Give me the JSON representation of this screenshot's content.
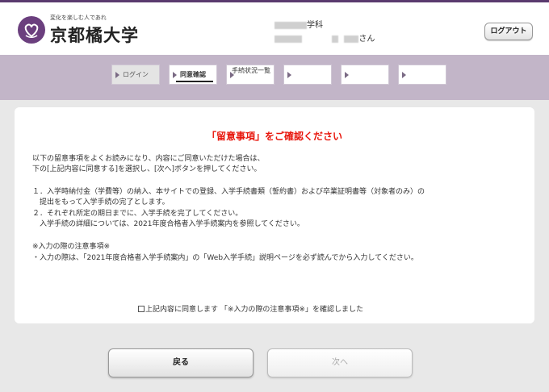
{
  "header": {
    "tagline": "変化を楽しむ人であれ",
    "university_name": "京都橘大学",
    "department_suffix": "学科",
    "user_suffix": "さん",
    "logout_label": "ログアウト"
  },
  "steps": [
    {
      "label": "ログイン",
      "state": "done"
    },
    {
      "label": "同意確認",
      "state": "current"
    },
    {
      "label": "手続状況一覧",
      "state": "todo"
    },
    {
      "label": "",
      "state": "todo"
    },
    {
      "label": "",
      "state": "todo"
    },
    {
      "label": "",
      "state": "todo"
    }
  ],
  "notice": {
    "title": "「留意事項」をご確認ください",
    "intro_1": "以下の留意事項をよくお読みになり、内容にご同意いただけた場合は、",
    "intro_2": "下の[上記内容に同意する]を選択し、[次へ]ボタンを押してください。",
    "item1_line1": "１．入学時納付金（学費等）の納入、本サイトでの登録、入学手続書類（誓約書）および卒業証明書等（対象者のみ）の",
    "item1_line2": "　提出をもって入学手続の完了とします。",
    "item2_line1": "２．それぞれ所定の期日までに、入学手続を完了してください。",
    "item2_line2": "　入学手続の詳細については、2021年度合格者入学手続案内を参照してください。",
    "caution_heading": "※入力の際の注意事項※",
    "caution_text": "・入力の際は、「2021年度合格者入学手続案内」の「Web入学手続」説明ページを必ず読んでから入力してください。",
    "agree_label": "上記内容に同意します 「※入力の際の注意事項※」を確認しました"
  },
  "buttons": {
    "back_label": "戻る",
    "next_label": "次へ"
  },
  "colors": {
    "brand_purple": "#6b3f7e",
    "stepbar_bg": "#c2b5c8",
    "title_red": "#e8160c"
  }
}
